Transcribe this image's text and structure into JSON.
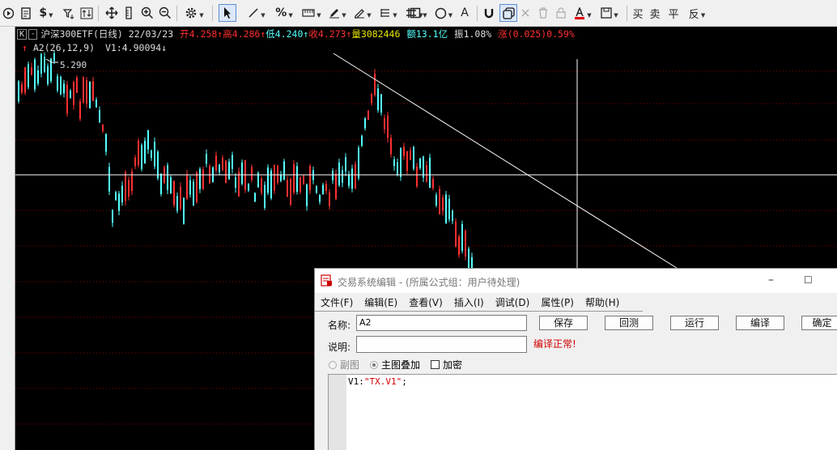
{
  "toolbar": {
    "icons": [
      "play-circle-icon",
      "document-icon",
      "dollar-icon",
      "filter-icon",
      "sort-icon",
      "move-icon",
      "ruler-icon",
      "zoom-in-icon",
      "zoom-out-icon",
      "gear-icon",
      "pointer-icon",
      "line-tool-icon",
      "percent-icon",
      "ruler-tool-icon",
      "pen-icon",
      "pencil-icon",
      "parallel-lines-icon",
      "grid-icon",
      "rectangle-icon",
      "circle-icon",
      "text-tool-icon",
      "magnet-icon",
      "copy-layer-icon",
      "delete-icon",
      "trash-icon",
      "lock-icon",
      "font-color-icon",
      "save-icon"
    ],
    "text_tool": "A",
    "buy": "买",
    "sell": "卖",
    "flat": "平",
    "reverse": "反"
  },
  "chart": {
    "k_button": "K",
    "minus_button": "-",
    "title": "沪深300ETF(日线) 22/03/23",
    "open_label": "开",
    "open_value": "4.258",
    "high_label": "高",
    "high_value": "4.286",
    "low_label": "低",
    "low_value": "4.240",
    "close_label": "收",
    "close_value": "4.273",
    "volume_label": "量",
    "volume_value": "3082446",
    "amount_label": "额",
    "amount_value": "13.1亿",
    "amplitude_label": "振",
    "amplitude_value": "1.08%",
    "change_label": "涨",
    "change_value": "(0.025)",
    "change_pct": "0.59%",
    "indicator": "A2(26,12,9)",
    "v1": "V1:4.90094",
    "high_marker": "5.290",
    "colors": {
      "up": "#ff3030",
      "down": "#54ffff",
      "grid": "#8b0000",
      "white": "#ffffff",
      "volume": "#e8e800"
    }
  },
  "dialog": {
    "title": "交易系统编辑 - (所属公式组：用户待处理)",
    "minimize": "–",
    "maximize": "☐",
    "menus": [
      "文件(F)",
      "编辑(E)",
      "查看(V)",
      "插入(I)",
      "调试(D)",
      "属性(P)",
      "帮助(H)"
    ],
    "name_label": "名称:",
    "name_value": "A2",
    "desc_label": "说明:",
    "desc_value": "",
    "buttons": [
      "保存",
      "回测",
      "运行",
      "编译",
      "确定"
    ],
    "status": "编译正常!",
    "options": [
      "副图",
      "主图叠加",
      "加密"
    ],
    "code_prefix": "V1:",
    "code_string": "\"TX.V1\"",
    "code_suffix": ";"
  }
}
